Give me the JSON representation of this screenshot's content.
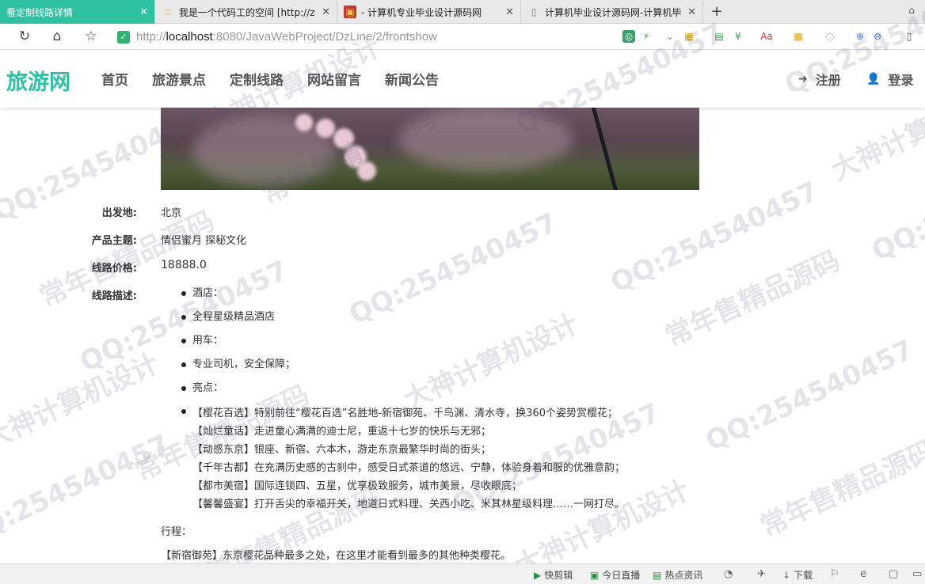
{
  "browser": {
    "tabs": [
      {
        "label": "看定制线路详情",
        "favicon": "page-icon",
        "active": true
      },
      {
        "label": "我是一个代码工的空间 [http://z",
        "favicon": "star-icon",
        "active": false
      },
      {
        "label": "- 计算机专业毕业设计源码网",
        "favicon": "site-icon",
        "active": false
      },
      {
        "label": "计算机毕业设计源码网-计算机毕",
        "favicon": "page-icon",
        "active": false
      }
    ],
    "new_tab": "+",
    "url": {
      "scheme": "http://",
      "host": "localhost",
      "path": ":8080/JavaWebProject/DzLine/2/frontshow"
    }
  },
  "site": {
    "logo": "旅游网",
    "menu": [
      "首页",
      "旅游景点",
      "定制线路",
      "网站留言",
      "新闻公告"
    ],
    "register": "注册",
    "login": "登录",
    "accent": "#2fc2a1"
  },
  "detail": {
    "departure_label": "出发地:",
    "departure": "北京",
    "theme_label": "产品主题:",
    "theme": "情侣蜜月 探秘文化",
    "price_label": "线路价格:",
    "price": "18888.0",
    "desc_label": "线路描述:",
    "desc_items": [
      "酒店：",
      "全程星级精品酒店",
      "用车：",
      "专业司机，安全保障；",
      "亮点："
    ],
    "highlights": [
      "【樱花百选】特别前往“樱花百选”名胜地-新宿御苑、千鸟渊、清水寺，换360个姿势赏樱花；",
      "【灿烂童话】走进童心满满的迪士尼，重返十七岁的快乐与无邪；",
      "【动感东京】银座、新宿、六本木，游走东京最繁华时尚的街头；",
      "【千年古都】在充满历史感的古刹中，感受日式茶道的悠远、宁静，体验身着和服的优雅意韵；",
      "【都市美宿】国际连锁四、五星，优享极致服务，城市美景，尽收眼底；",
      "【馨馨盛宴】打开舌尖的幸福开关，地道日式料理、关西小吃、米其林星级料理……一网打尽。"
    ],
    "itinerary_label": "行程：",
    "itinerary_first": "【新宿御苑】东京樱花品种最多之处，在这里才能看到最多的其他种类樱花。"
  },
  "statusbar": {
    "items": [
      "快剪辑",
      "今日直播",
      "热点资讯",
      "下载"
    ]
  },
  "watermark": [
    "QQ:254540457",
    "常年售精品源码",
    "大神计算机设计"
  ]
}
